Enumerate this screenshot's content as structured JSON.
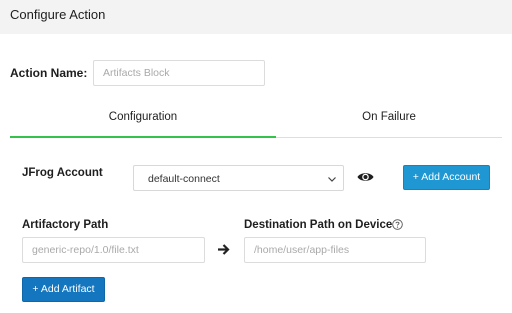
{
  "header": {
    "title": "Configure Action"
  },
  "action_name": {
    "label": "Action Name:",
    "placeholder": "Artifacts Block"
  },
  "tabs": [
    {
      "label": "Configuration",
      "active": true
    },
    {
      "label": "On Failure",
      "active": false
    }
  ],
  "jfrog": {
    "label": "JFrog Account",
    "selected": "default-connect",
    "add_button": "+ Add Account"
  },
  "artifactory": {
    "label": "Artifactory Path",
    "placeholder": "generic-repo/1.0/file.txt"
  },
  "destination": {
    "label": "Destination Path on Device",
    "placeholder": "/home/user/app-files"
  },
  "add_artifact_button": "+ Add Artifact",
  "colors": {
    "accent": "#1f97d2",
    "tab_active": "#34c34a",
    "header_bg": "#f3f3f3"
  }
}
